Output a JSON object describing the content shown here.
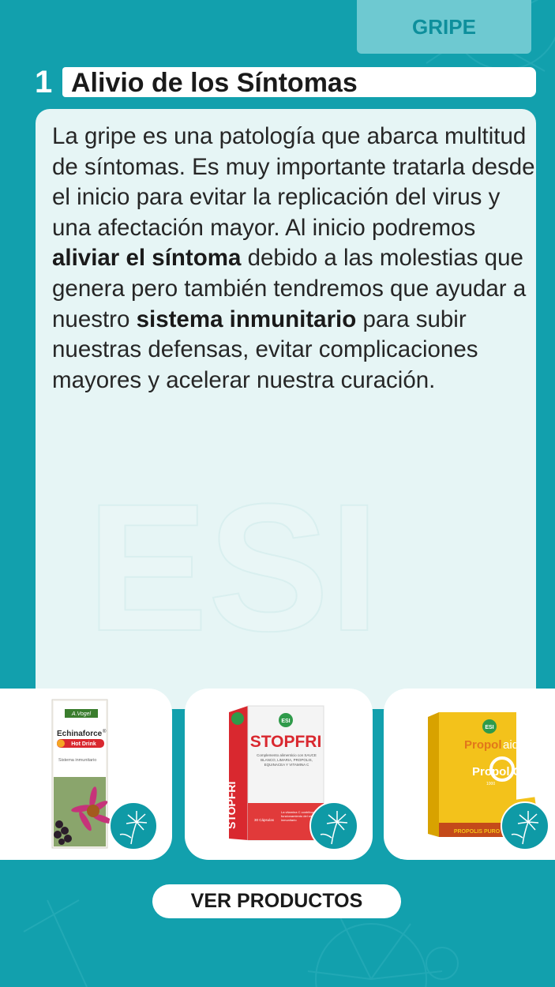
{
  "header": {
    "tab_label": "GRIPE"
  },
  "section": {
    "number": "1",
    "title": "Alivio de los Síntomas"
  },
  "body": {
    "segments": [
      "La gripe es una patología que abarca multitud de síntomas. Es muy importante tratarla desde el inicio para evitar la replicación del virus y una afectación mayor. Al inicio podremos ",
      "aliviar el síntoma",
      " debido a las molestias que genera pero también tendremos que ayudar a nuestro ",
      "sistema inmunitario",
      " para subir nuestras defensas, evitar complicaciones mayores y acelerar nuestra curación."
    ]
  },
  "products": [
    {
      "brand": "A.Vogel",
      "name": "Echinaforce",
      "name_mark": "®",
      "tag": "Hot Drink",
      "subtitle": "Sistema inmunitario"
    },
    {
      "brand": "ESI",
      "name": "STOPFRI",
      "description": "Complemento alimenticio con SAUCE BLANCO, LIMARIA, PROPOLIS, EQUINACEA Y VITAMINA C",
      "count": "30 Cápsulas",
      "claim": "La vitamina C contribuye al funcionamiento del sistema inmunitario"
    },
    {
      "brand": "ESI",
      "name_prefix": "Propol",
      "name_suffix": "aid",
      "sub_name": "Propol C",
      "dose": "1000",
      "footer": "PROPOLIS PURO"
    }
  ],
  "cta": {
    "label": "VER PRODUCTOS"
  },
  "colors": {
    "background": "#12a0ad",
    "card": "#e6f5f5",
    "tab": "#6ec9d1",
    "accent_red": "#d9282f"
  },
  "icons": [
    "dandelion-icon"
  ]
}
